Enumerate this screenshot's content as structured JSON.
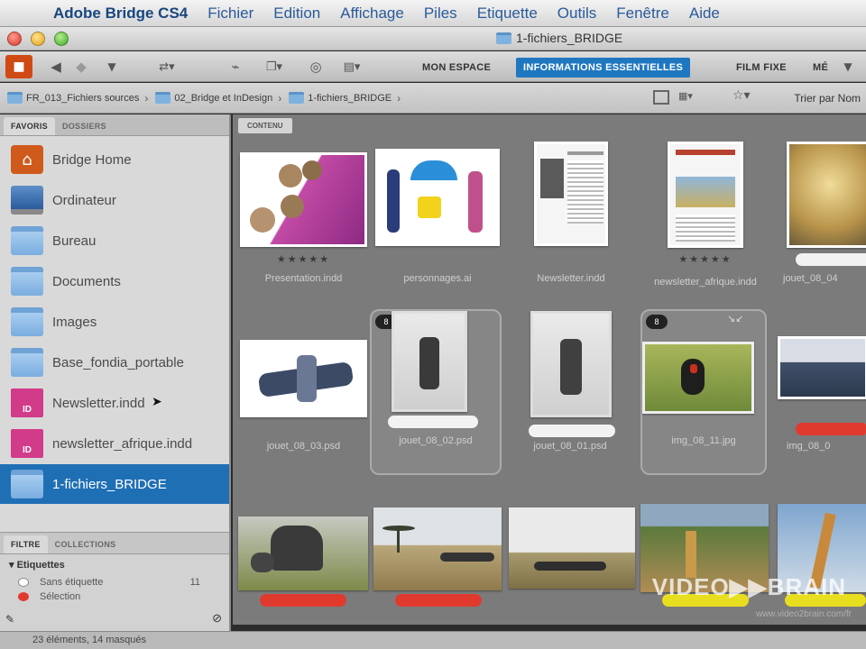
{
  "menubar": {
    "app": "Adobe Bridge CS4",
    "items": [
      "Fichier",
      "Edition",
      "Affichage",
      "Piles",
      "Etiquette",
      "Outils",
      "Fenêtre",
      "Aide"
    ]
  },
  "window": {
    "title": "1-fichiers_BRIDGE"
  },
  "toolbar": {
    "workspaces": [
      "MON ESPACE",
      "INFORMATIONS ESSENTIELLES",
      "FILM FIXE",
      "MÉ"
    ],
    "active_workspace": "INFORMATIONS ESSENTIELLES",
    "accent": "#1f77c0"
  },
  "path": {
    "crumbs": [
      "FR_013_Fichiers sources",
      "02_Bridge et InDesign",
      "1-fichiers_BRIDGE"
    ],
    "sort_label": "Trier par Nom"
  },
  "left_panel": {
    "tabs": [
      "FAVORIS",
      "DOSSIERS"
    ],
    "favorites": [
      {
        "label": "Bridge Home",
        "icon": "home-icon"
      },
      {
        "label": "Ordinateur",
        "icon": "computer-icon"
      },
      {
        "label": "Bureau",
        "icon": "folder-icon"
      },
      {
        "label": "Documents",
        "icon": "folder-icon"
      },
      {
        "label": "Images",
        "icon": "folder-icon"
      },
      {
        "label": "Base_fondia_portable",
        "icon": "folder-icon"
      },
      {
        "label": "Newsletter.indd",
        "icon": "indd-file-icon"
      },
      {
        "label": "newsletter_afrique.indd",
        "icon": "indd-file-icon"
      },
      {
        "label": "1-fichiers_BRIDGE",
        "icon": "folder-icon",
        "selected": true
      }
    ],
    "filter_tabs": [
      "FILTRE",
      "COLLECTIONS"
    ],
    "filter": {
      "heading": "Etiquettes",
      "rows": [
        {
          "label": "Sans étiquette",
          "count": "11"
        },
        {
          "label": "Sélection",
          "count": ""
        }
      ]
    }
  },
  "content": {
    "tab": "CONTENU",
    "row1": [
      {
        "name": "Presentation.indd",
        "stars": "★★★★★"
      },
      {
        "name": "personnages.ai",
        "stars": ""
      },
      {
        "name": "Newsletter.indd",
        "stars": ""
      },
      {
        "name": "newsletter_afrique.indd",
        "stars": "★★★★★"
      },
      {
        "name": "jouet_08_04",
        "stars": ""
      }
    ],
    "row2": [
      {
        "name": "jouet_08_03.psd",
        "badge": ""
      },
      {
        "name": "jouet_08_02.psd",
        "badge": "8"
      },
      {
        "name": "jouet_08_01.psd",
        "badge": ""
      },
      {
        "name": "img_08_11.jpg",
        "badge": "8"
      },
      {
        "name": "img_08_0",
        "badge": ""
      }
    ],
    "label_colors": {
      "red": "#e03a2f",
      "yellow": "#e8de20",
      "white": "#f2f2f2"
    }
  },
  "status": {
    "text": "23 éléments, 14 masqués"
  },
  "watermark": {
    "brand": "VIDEO▶▶BRAIN",
    "url": "www.video2brain.com/fr"
  }
}
